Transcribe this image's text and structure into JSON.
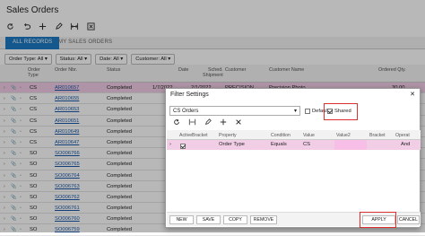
{
  "screen_title": "Sales Orders",
  "toolbar": {
    "icons": [
      "refresh-icon",
      "undo-icon",
      "add-icon",
      "edit-icon",
      "fit-columns-icon",
      "export-icon"
    ]
  },
  "tabs": [
    {
      "label": "ALL RECORDS"
    },
    {
      "label": "MY SALES ORDERS"
    }
  ],
  "filters": [
    {
      "label": "Order Type: All ▾"
    },
    {
      "label": "Status: All ▾"
    },
    {
      "label": "Date: All ▾"
    },
    {
      "label": "Customer: All ▾"
    }
  ],
  "grid": {
    "headers": {
      "order_type": "Order\nType",
      "order_nbr": "Order Nbr.",
      "status": "Status",
      "date": "Date",
      "sched": "Sched.\nShipment",
      "customer": "Customer",
      "customer_name": "Customer Name",
      "ordered_qty": "Ordered Qty."
    },
    "rows": [
      {
        "type": "CS",
        "nbr": "AR010657",
        "status": "Completed",
        "date": "1/7/2022",
        "sched": "2/1/2022",
        "customer": "PRECISION",
        "name": "Precision Photo",
        "qty": "30.00"
      },
      {
        "type": "CS",
        "nbr": "AR010655",
        "status": "Completed",
        "date": "",
        "sched": "",
        "customer": "",
        "name": "",
        "qty": ""
      },
      {
        "type": "CS",
        "nbr": "AR010653",
        "status": "Completed",
        "date": "",
        "sched": "",
        "customer": "",
        "name": "",
        "qty": ""
      },
      {
        "type": "CS",
        "nbr": "AR010651",
        "status": "Completed",
        "date": "",
        "sched": "",
        "customer": "",
        "name": "",
        "qty": ""
      },
      {
        "type": "CS",
        "nbr": "AR010649",
        "status": "Completed",
        "date": "",
        "sched": "",
        "customer": "",
        "name": "",
        "qty": ""
      },
      {
        "type": "CS",
        "nbr": "AR010647",
        "status": "Completed",
        "date": "",
        "sched": "",
        "customer": "",
        "name": "",
        "qty": ""
      },
      {
        "type": "SO",
        "nbr": "SO006766",
        "status": "Completed",
        "date": "",
        "sched": "",
        "customer": "",
        "name": "",
        "qty": ""
      },
      {
        "type": "SO",
        "nbr": "SO006765",
        "status": "Completed",
        "date": "",
        "sched": "",
        "customer": "",
        "name": "",
        "qty": ""
      },
      {
        "type": "SO",
        "nbr": "SO006764",
        "status": "Completed",
        "date": "",
        "sched": "",
        "customer": "",
        "name": "",
        "qty": ""
      },
      {
        "type": "SO",
        "nbr": "SO006763",
        "status": "Completed",
        "date": "",
        "sched": "",
        "customer": "",
        "name": "",
        "qty": ""
      },
      {
        "type": "SO",
        "nbr": "SO006762",
        "status": "Completed",
        "date": "",
        "sched": "",
        "customer": "",
        "name": "",
        "qty": ""
      },
      {
        "type": "SO",
        "nbr": "SO006761",
        "status": "Completed",
        "date": "",
        "sched": "",
        "customer": "",
        "name": "",
        "qty": ""
      },
      {
        "type": "SO",
        "nbr": "SO006760",
        "status": "Completed",
        "date": "",
        "sched": "",
        "customer": "",
        "name": "",
        "qty": ""
      },
      {
        "type": "SO",
        "nbr": "SO006759",
        "status": "Completed",
        "date": "",
        "sched": "",
        "customer": "",
        "name": "",
        "qty": ""
      }
    ]
  },
  "dialog": {
    "title": "Filter Settings",
    "close": "✕",
    "filter_name": "CS Orders",
    "default_label": "Default",
    "shared_label": "Shared",
    "shared_checked": true,
    "default_checked": false,
    "toolbar_icons": [
      "refresh-icon",
      "fit-columns-icon",
      "edit-icon",
      "add-icon",
      "delete-icon"
    ],
    "headers": {
      "active": "Active",
      "bracket": "Bracket",
      "property": "Property",
      "condition": "Condition",
      "value": "Value",
      "value2": "Value2",
      "bracket2": "Bracket",
      "operator": "Operat"
    },
    "row": {
      "property": "Order Type",
      "condition": "Equals",
      "value": "CS",
      "operator": "And"
    },
    "buttons": {
      "new": "NEW",
      "save": "SAVE",
      "copy": "COPY",
      "remove": "REMOVE",
      "apply": "APPLY",
      "cancel": "CANCEL"
    }
  },
  "colors": {
    "accent": "#1e7bc4",
    "selected_row": "#f2cde6",
    "highlight": "#d93030"
  }
}
